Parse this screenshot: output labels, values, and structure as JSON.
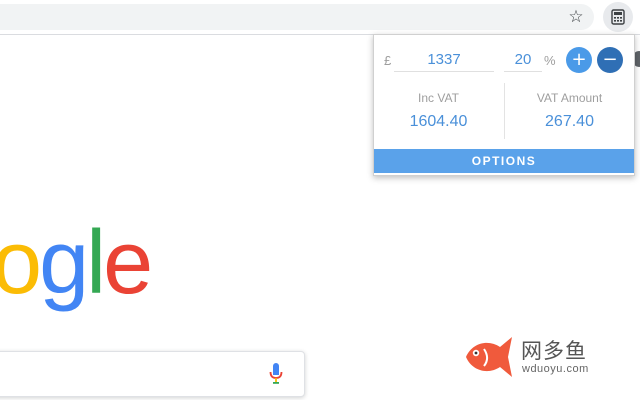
{
  "browser": {
    "bookmark_icon": "star-icon",
    "extension_icon": "calculator-icon"
  },
  "vat_popup": {
    "currency_symbol": "£",
    "amount_value": "1337",
    "rate_value": "20",
    "percent_symbol": "%",
    "add_button_label": "+",
    "subtract_button_label": "−",
    "inc_vat_label": "Inc VAT",
    "inc_vat_value": "1604.40",
    "vat_amount_label": "VAT Amount",
    "vat_amount_value": "267.40",
    "options_label": "OPTIONS",
    "colors": {
      "accent": "#4a90d9",
      "options_bar": "#5aa2ea",
      "add_button": "#4a9ae8",
      "subtract_button": "#2f6fb5"
    }
  },
  "google": {
    "logo_letters": [
      "o",
      "g",
      "l",
      "e"
    ],
    "logo_colors": [
      "#fbbc05",
      "#4285f4",
      "#34a853",
      "#ea4335"
    ],
    "mic_icon": "microphone-icon"
  },
  "watermark": {
    "title": "网多鱼",
    "subtitle": "wduoyu.com"
  }
}
